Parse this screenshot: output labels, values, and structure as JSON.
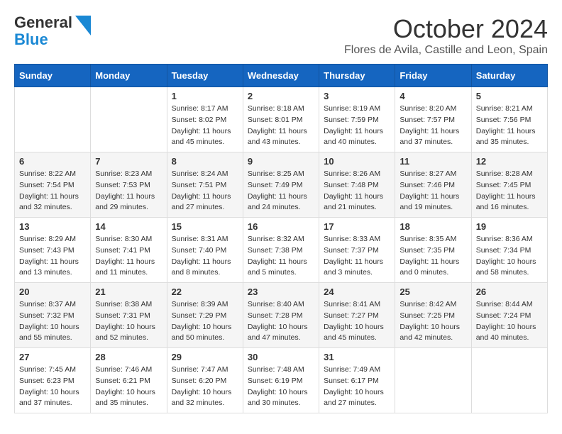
{
  "header": {
    "logo_general": "General",
    "logo_blue": "Blue",
    "month_title": "October 2024",
    "location": "Flores de Avila, Castille and Leon, Spain"
  },
  "weekdays": [
    "Sunday",
    "Monday",
    "Tuesday",
    "Wednesday",
    "Thursday",
    "Friday",
    "Saturday"
  ],
  "weeks": [
    [
      {
        "day": "",
        "sunrise": "",
        "sunset": "",
        "daylight": ""
      },
      {
        "day": "",
        "sunrise": "",
        "sunset": "",
        "daylight": ""
      },
      {
        "day": "1",
        "sunrise": "Sunrise: 8:17 AM",
        "sunset": "Sunset: 8:02 PM",
        "daylight": "Daylight: 11 hours and 45 minutes."
      },
      {
        "day": "2",
        "sunrise": "Sunrise: 8:18 AM",
        "sunset": "Sunset: 8:01 PM",
        "daylight": "Daylight: 11 hours and 43 minutes."
      },
      {
        "day": "3",
        "sunrise": "Sunrise: 8:19 AM",
        "sunset": "Sunset: 7:59 PM",
        "daylight": "Daylight: 11 hours and 40 minutes."
      },
      {
        "day": "4",
        "sunrise": "Sunrise: 8:20 AM",
        "sunset": "Sunset: 7:57 PM",
        "daylight": "Daylight: 11 hours and 37 minutes."
      },
      {
        "day": "5",
        "sunrise": "Sunrise: 8:21 AM",
        "sunset": "Sunset: 7:56 PM",
        "daylight": "Daylight: 11 hours and 35 minutes."
      }
    ],
    [
      {
        "day": "6",
        "sunrise": "Sunrise: 8:22 AM",
        "sunset": "Sunset: 7:54 PM",
        "daylight": "Daylight: 11 hours and 32 minutes."
      },
      {
        "day": "7",
        "sunrise": "Sunrise: 8:23 AM",
        "sunset": "Sunset: 7:53 PM",
        "daylight": "Daylight: 11 hours and 29 minutes."
      },
      {
        "day": "8",
        "sunrise": "Sunrise: 8:24 AM",
        "sunset": "Sunset: 7:51 PM",
        "daylight": "Daylight: 11 hours and 27 minutes."
      },
      {
        "day": "9",
        "sunrise": "Sunrise: 8:25 AM",
        "sunset": "Sunset: 7:49 PM",
        "daylight": "Daylight: 11 hours and 24 minutes."
      },
      {
        "day": "10",
        "sunrise": "Sunrise: 8:26 AM",
        "sunset": "Sunset: 7:48 PM",
        "daylight": "Daylight: 11 hours and 21 minutes."
      },
      {
        "day": "11",
        "sunrise": "Sunrise: 8:27 AM",
        "sunset": "Sunset: 7:46 PM",
        "daylight": "Daylight: 11 hours and 19 minutes."
      },
      {
        "day": "12",
        "sunrise": "Sunrise: 8:28 AM",
        "sunset": "Sunset: 7:45 PM",
        "daylight": "Daylight: 11 hours and 16 minutes."
      }
    ],
    [
      {
        "day": "13",
        "sunrise": "Sunrise: 8:29 AM",
        "sunset": "Sunset: 7:43 PM",
        "daylight": "Daylight: 11 hours and 13 minutes."
      },
      {
        "day": "14",
        "sunrise": "Sunrise: 8:30 AM",
        "sunset": "Sunset: 7:41 PM",
        "daylight": "Daylight: 11 hours and 11 minutes."
      },
      {
        "day": "15",
        "sunrise": "Sunrise: 8:31 AM",
        "sunset": "Sunset: 7:40 PM",
        "daylight": "Daylight: 11 hours and 8 minutes."
      },
      {
        "day": "16",
        "sunrise": "Sunrise: 8:32 AM",
        "sunset": "Sunset: 7:38 PM",
        "daylight": "Daylight: 11 hours and 5 minutes."
      },
      {
        "day": "17",
        "sunrise": "Sunrise: 8:33 AM",
        "sunset": "Sunset: 7:37 PM",
        "daylight": "Daylight: 11 hours and 3 minutes."
      },
      {
        "day": "18",
        "sunrise": "Sunrise: 8:35 AM",
        "sunset": "Sunset: 7:35 PM",
        "daylight": "Daylight: 11 hours and 0 minutes."
      },
      {
        "day": "19",
        "sunrise": "Sunrise: 8:36 AM",
        "sunset": "Sunset: 7:34 PM",
        "daylight": "Daylight: 10 hours and 58 minutes."
      }
    ],
    [
      {
        "day": "20",
        "sunrise": "Sunrise: 8:37 AM",
        "sunset": "Sunset: 7:32 PM",
        "daylight": "Daylight: 10 hours and 55 minutes."
      },
      {
        "day": "21",
        "sunrise": "Sunrise: 8:38 AM",
        "sunset": "Sunset: 7:31 PM",
        "daylight": "Daylight: 10 hours and 52 minutes."
      },
      {
        "day": "22",
        "sunrise": "Sunrise: 8:39 AM",
        "sunset": "Sunset: 7:29 PM",
        "daylight": "Daylight: 10 hours and 50 minutes."
      },
      {
        "day": "23",
        "sunrise": "Sunrise: 8:40 AM",
        "sunset": "Sunset: 7:28 PM",
        "daylight": "Daylight: 10 hours and 47 minutes."
      },
      {
        "day": "24",
        "sunrise": "Sunrise: 8:41 AM",
        "sunset": "Sunset: 7:27 PM",
        "daylight": "Daylight: 10 hours and 45 minutes."
      },
      {
        "day": "25",
        "sunrise": "Sunrise: 8:42 AM",
        "sunset": "Sunset: 7:25 PM",
        "daylight": "Daylight: 10 hours and 42 minutes."
      },
      {
        "day": "26",
        "sunrise": "Sunrise: 8:44 AM",
        "sunset": "Sunset: 7:24 PM",
        "daylight": "Daylight: 10 hours and 40 minutes."
      }
    ],
    [
      {
        "day": "27",
        "sunrise": "Sunrise: 7:45 AM",
        "sunset": "Sunset: 6:23 PM",
        "daylight": "Daylight: 10 hours and 37 minutes."
      },
      {
        "day": "28",
        "sunrise": "Sunrise: 7:46 AM",
        "sunset": "Sunset: 6:21 PM",
        "daylight": "Daylight: 10 hours and 35 minutes."
      },
      {
        "day": "29",
        "sunrise": "Sunrise: 7:47 AM",
        "sunset": "Sunset: 6:20 PM",
        "daylight": "Daylight: 10 hours and 32 minutes."
      },
      {
        "day": "30",
        "sunrise": "Sunrise: 7:48 AM",
        "sunset": "Sunset: 6:19 PM",
        "daylight": "Daylight: 10 hours and 30 minutes."
      },
      {
        "day": "31",
        "sunrise": "Sunrise: 7:49 AM",
        "sunset": "Sunset: 6:17 PM",
        "daylight": "Daylight: 10 hours and 27 minutes."
      },
      {
        "day": "",
        "sunrise": "",
        "sunset": "",
        "daylight": ""
      },
      {
        "day": "",
        "sunrise": "",
        "sunset": "",
        "daylight": ""
      }
    ]
  ]
}
